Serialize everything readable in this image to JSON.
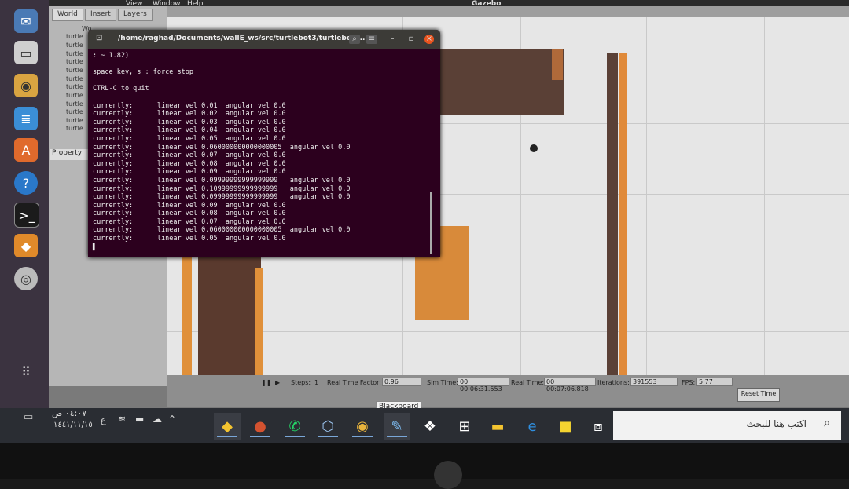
{
  "topbar": {
    "menu_view": "View",
    "menu_window": "Window",
    "menu_help": "Help",
    "app_name": "Gazebo"
  },
  "left_panel": {
    "tabs": [
      "World",
      "Insert",
      "Layers"
    ],
    "tree_items": [
      "Wo",
      "turtle",
      "turtle",
      "turtle",
      "turtle",
      "turtle",
      "turtle",
      "turtle",
      "turtle",
      "turtle",
      "turtle",
      "turtle",
      "turtle"
    ],
    "property_label": "Property"
  },
  "terminal": {
    "title": "/home/raghad/Documents/wallE_ws/src/turtlebot3/turtlebot3...",
    "lines": [
      ": ~ 1.82)",
      "",
      "space key, s : force stop",
      "",
      "CTRL-C to quit",
      "",
      "currently:      linear vel 0.01  angular vel 0.0",
      "currently:      linear vel 0.02  angular vel 0.0",
      "currently:      linear vel 0.03  angular vel 0.0",
      "currently:      linear vel 0.04  angular vel 0.0",
      "currently:      linear vel 0.05  angular vel 0.0",
      "currently:      linear vel 0.060000000000000005  angular vel 0.0",
      "currently:      linear vel 0.07  angular vel 0.0",
      "currently:      linear vel 0.08  angular vel 0.0",
      "currently:      linear vel 0.09  angular vel 0.0",
      "currently:      linear vel 0.09999999999999999   angular vel 0.0",
      "currently:      linear vel 0.10999999999999999   angular vel 0.0",
      "currently:      linear vel 0.09999999999999999   angular vel 0.0",
      "currently:      linear vel 0.09  angular vel 0.0",
      "currently:      linear vel 0.08  angular vel 0.0",
      "currently:      linear vel 0.07  angular vel 0.0",
      "currently:      linear vel 0.060000000000000005  angular vel 0.0",
      "currently:      linear vel 0.05  angular vel 0.0",
      "▌"
    ]
  },
  "statusbar": {
    "steps_label": "Steps:",
    "steps_value": "1",
    "rtf_label": "Real Time Factor:",
    "rtf_value": "0.96",
    "sim_time_label": "Sim Time:",
    "sim_time_value": "00 00:06:31.553",
    "real_time_label": "Real Time:",
    "real_time_value": "00 00:07:06.818",
    "iterations_label": "Iterations:",
    "iterations_value": "391553",
    "fps_label": "FPS:",
    "fps_value": "5.77",
    "reset_button": "Reset Time"
  },
  "taskbar": {
    "time": "٠٤:٠٧ ص",
    "date": "١٤٤١/١١/١٥",
    "lang": "ع",
    "tooltip": "Blackboard",
    "search_placeholder": "اكتب هنا للبحث"
  },
  "colors": {
    "terminal_bg": "#2c001e",
    "launcher_bg": "#3b3340",
    "taskbar_bg": "#2a2d33"
  }
}
